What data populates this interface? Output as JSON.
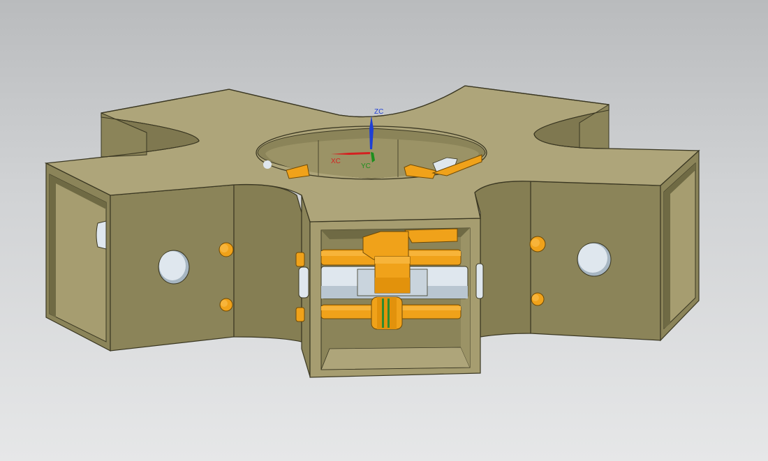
{
  "viewport": {
    "background_top": "#b9bbbd",
    "background_bottom": "#e6e7e8"
  },
  "colors": {
    "body_top": "#aea57a",
    "body_side": "#8b8459",
    "body_dark": "#6f6a44",
    "body_inner": "#a69d70",
    "edge": "#3a3722",
    "pin_orange": "#f0a21a",
    "pin_orange_dark": "#c47a05",
    "bearing_white": "#dfe7ee",
    "bearing_shade": "#a7b6c2",
    "ring_green": "#2e8b2e"
  },
  "triad": {
    "zc_label": "ZC",
    "xc_label": "XC",
    "yc_label": "YC",
    "zc_color": "#1e3fd6",
    "xc_color": "#d42020",
    "yc_color": "#1d8f1d"
  }
}
